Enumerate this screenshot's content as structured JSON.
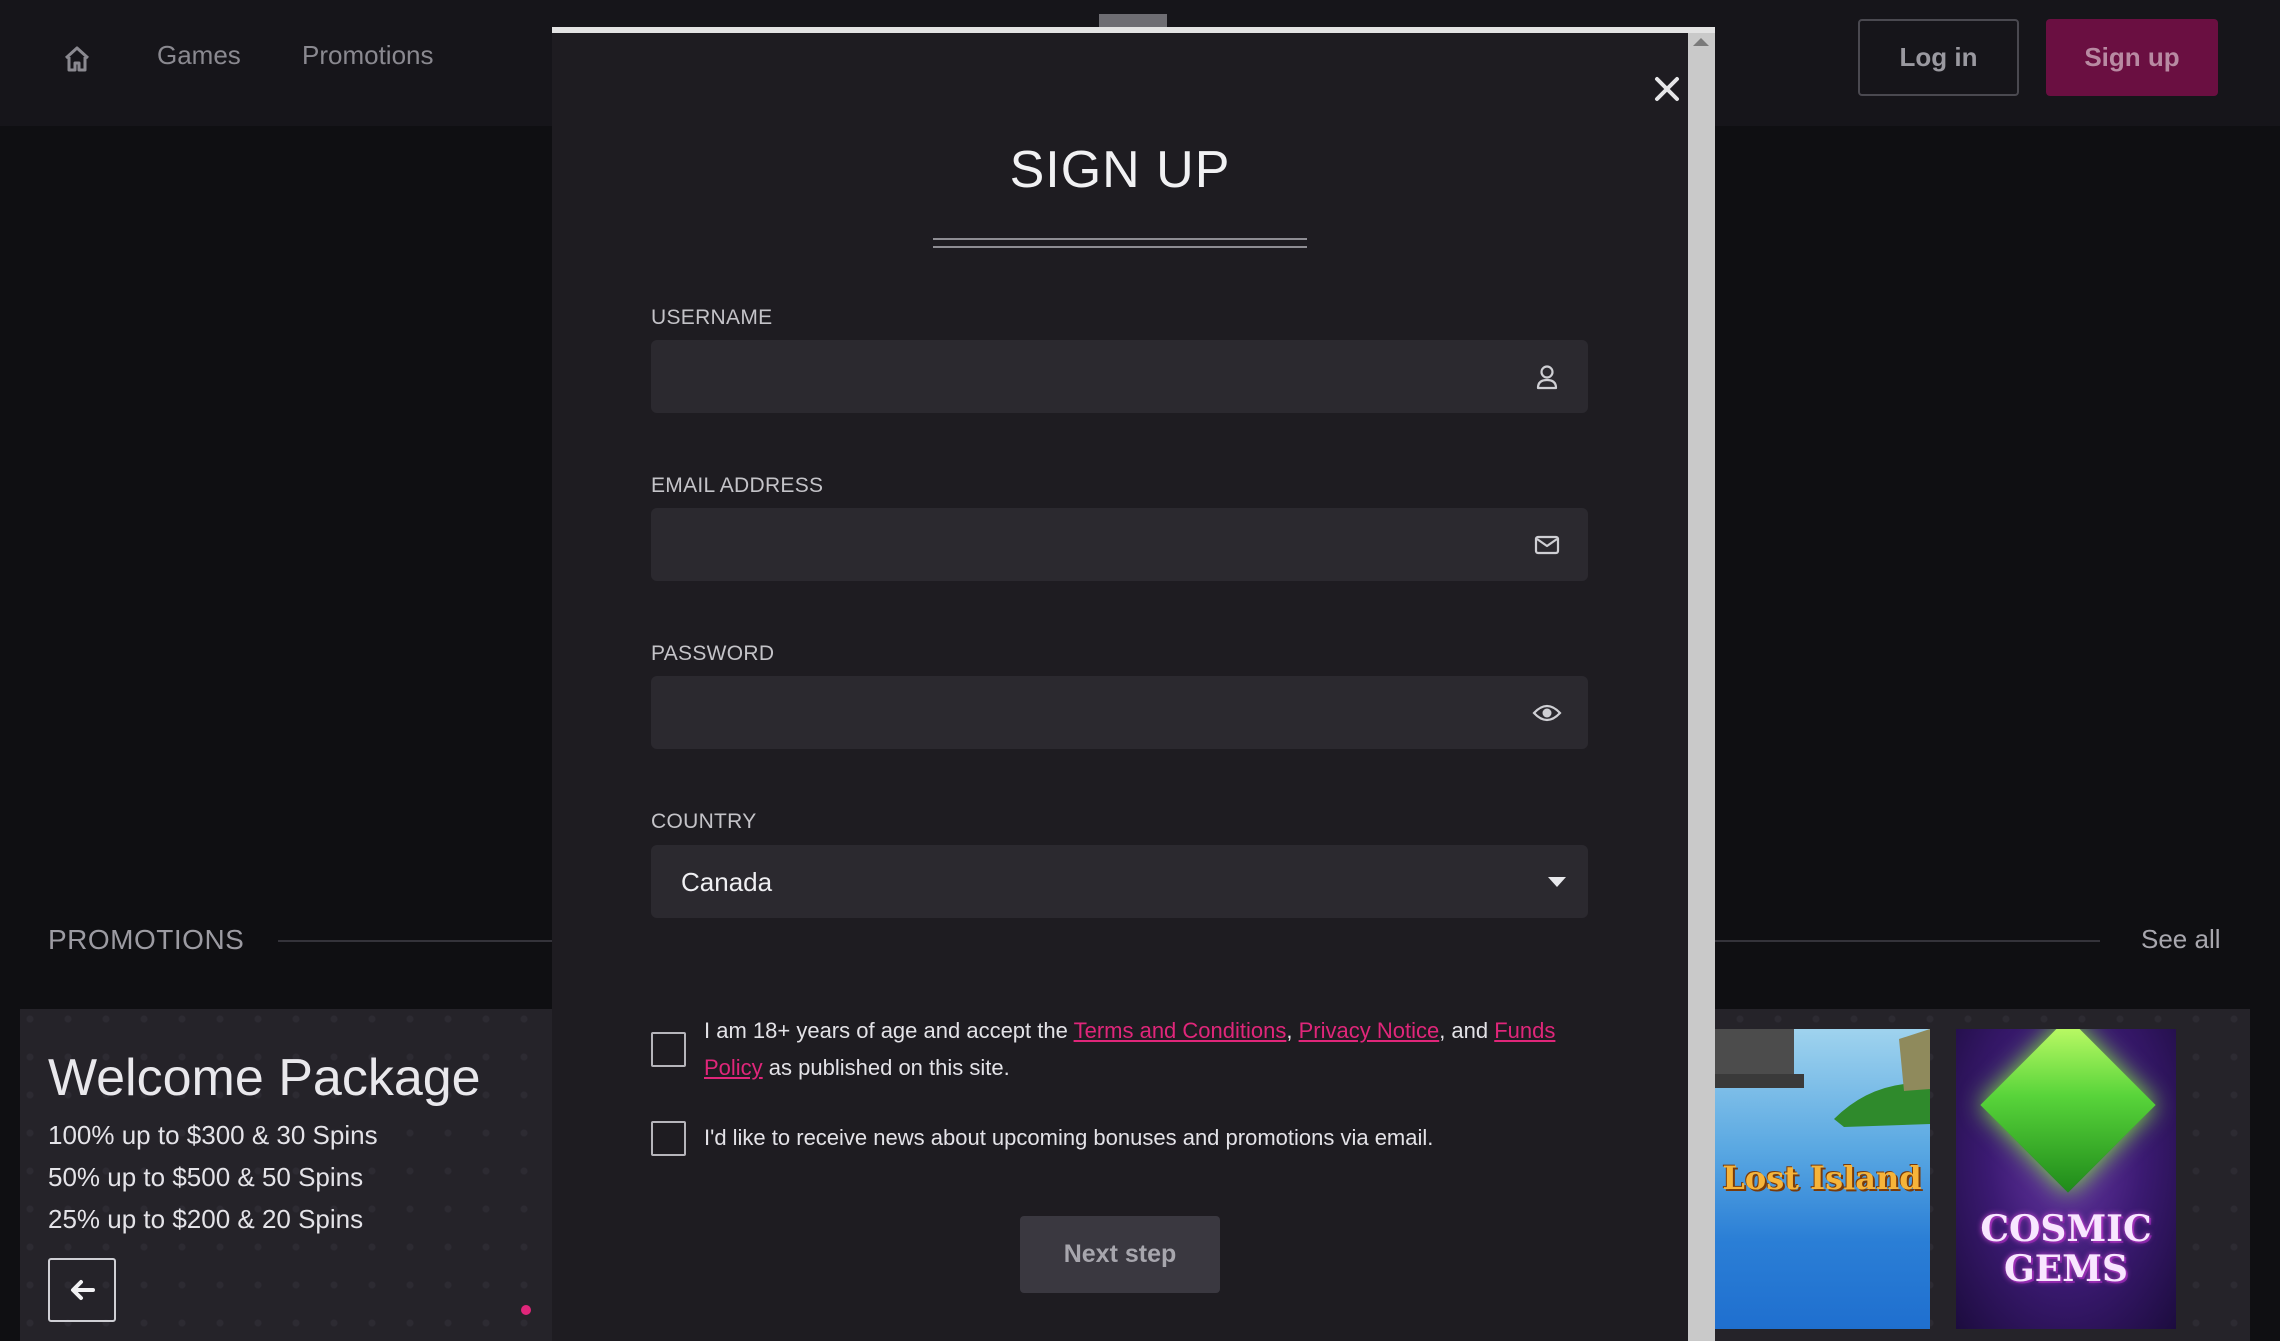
{
  "header": {
    "nav": {
      "home_icon": "home-icon",
      "games": "Games",
      "promotions": "Promotions"
    },
    "login_label": "Log in",
    "signup_label": "Sign up",
    "accent_color": "#6a0f41"
  },
  "promotions": {
    "heading": "PROMOTIONS",
    "see_all": "See all",
    "card": {
      "title": "Welcome Package",
      "lines": [
        "100% up to $300 & 30 Spins",
        "50% up to $500 & 50 Spins",
        "25% up to $200 & 20 Spins"
      ],
      "prev_icon": "arrow-left-icon"
    },
    "games": [
      {
        "title": "Lost Island"
      },
      {
        "title": "COSMIC GEMS"
      }
    ]
  },
  "modal": {
    "title": "SIGN UP",
    "close_icon": "close-icon",
    "fields": {
      "username": {
        "label": "USERNAME",
        "value": "",
        "icon": "user-icon"
      },
      "email": {
        "label": "EMAIL ADDRESS",
        "value": "",
        "icon": "envelope-icon"
      },
      "password": {
        "label": "PASSWORD",
        "value": "",
        "icon": "eye-icon"
      },
      "country": {
        "label": "COUNTRY",
        "value": "Canada"
      }
    },
    "consent": {
      "text_1": "I am 18+ years of age and accept the ",
      "terms_link": "Terms and Conditions",
      "sep_1": ", ",
      "privacy_link": "Privacy Notice",
      "sep_2": ", and ",
      "funds_link": "Funds Policy",
      "text_2": " as published on this site."
    },
    "newsletter": "I'd like to receive news about upcoming bonuses and promotions via email.",
    "next_label": "Next step",
    "link_color": "#e0267a"
  }
}
